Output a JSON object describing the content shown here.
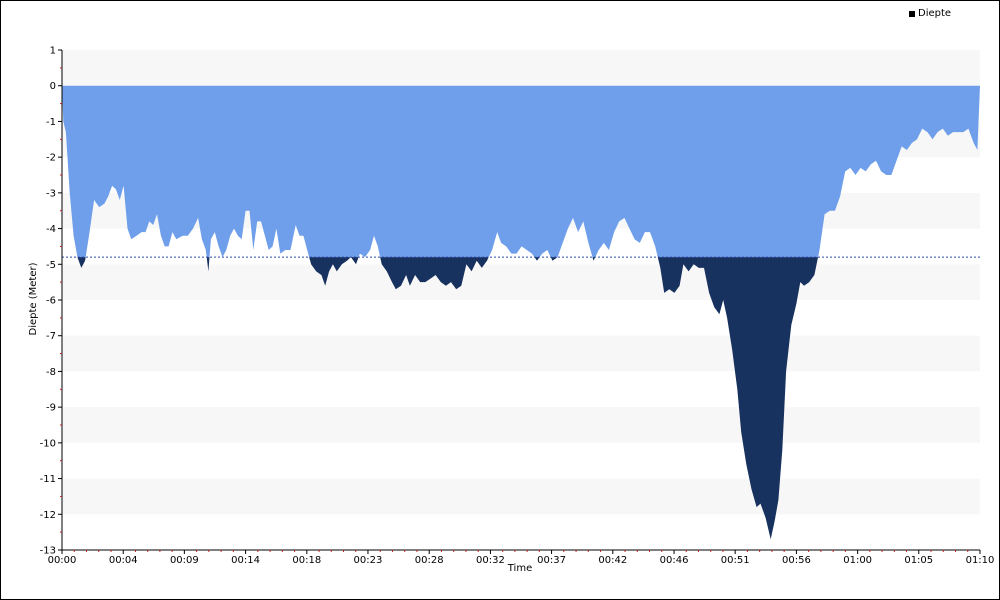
{
  "chart_data": {
    "type": "area",
    "title": "",
    "xlabel": "Time",
    "ylabel": "Diepte (Meter)",
    "legend": {
      "position": "top-right",
      "label": "Diepte"
    },
    "ylim": [
      -13,
      1
    ],
    "y_ticks": [
      "1",
      "0",
      "-1",
      "-2",
      "-3",
      "-4",
      "-5",
      "-6",
      "-7",
      "-8",
      "-9",
      "-10",
      "-11",
      "-12",
      "-13"
    ],
    "x_range_minutes": [
      0,
      71.5
    ],
    "x_ticks": [
      {
        "t": 0,
        "label": "00:00"
      },
      {
        "t": 4.77,
        "label": "00:04"
      },
      {
        "t": 9.53,
        "label": "00:09"
      },
      {
        "t": 14.3,
        "label": "00:14"
      },
      {
        "t": 19.07,
        "label": "00:18"
      },
      {
        "t": 23.83,
        "label": "00:23"
      },
      {
        "t": 28.6,
        "label": "00:28"
      },
      {
        "t": 33.37,
        "label": "00:32"
      },
      {
        "t": 38.13,
        "label": "00:37"
      },
      {
        "t": 42.9,
        "label": "00:42"
      },
      {
        "t": 47.67,
        "label": "00:46"
      },
      {
        "t": 52.43,
        "label": "00:51"
      },
      {
        "t": 57.2,
        "label": "00:56"
      },
      {
        "t": 61.97,
        "label": "01:00"
      },
      {
        "t": 66.73,
        "label": "01:05"
      },
      {
        "t": 71.5,
        "label": "01:10"
      }
    ],
    "threshold": -4.8,
    "grid": true,
    "colors": {
      "above": "#6f9fea",
      "below": "#18325f",
      "band": "#f7f7f7",
      "threshold_line": "#2a4aaa",
      "tick_mark": "#c02020"
    },
    "series": [
      {
        "name": "Diepte",
        "points": [
          [
            0,
            0
          ],
          [
            0.1,
            -1.0
          ],
          [
            0.3,
            -1.3
          ],
          [
            0.6,
            -3.0
          ],
          [
            0.9,
            -4.2
          ],
          [
            1.2,
            -4.8
          ],
          [
            1.5,
            -5.1
          ],
          [
            1.8,
            -4.9
          ],
          [
            2.1,
            -4.2
          ],
          [
            2.5,
            -3.2
          ],
          [
            2.9,
            -3.4
          ],
          [
            3.3,
            -3.3
          ],
          [
            3.6,
            -3.1
          ],
          [
            3.9,
            -2.8
          ],
          [
            4.2,
            -2.9
          ],
          [
            4.5,
            -3.2
          ],
          [
            4.8,
            -2.8
          ],
          [
            5.1,
            -4.0
          ],
          [
            5.4,
            -4.3
          ],
          [
            5.8,
            -4.2
          ],
          [
            6.2,
            -4.1
          ],
          [
            6.5,
            -4.1
          ],
          [
            6.8,
            -3.8
          ],
          [
            7.1,
            -3.9
          ],
          [
            7.4,
            -3.6
          ],
          [
            7.7,
            -4.2
          ],
          [
            8.0,
            -4.5
          ],
          [
            8.3,
            -4.5
          ],
          [
            8.6,
            -4.1
          ],
          [
            8.9,
            -4.3
          ],
          [
            9.4,
            -4.2
          ],
          [
            9.8,
            -4.2
          ],
          [
            10.2,
            -4.0
          ],
          [
            10.6,
            -3.7
          ],
          [
            10.9,
            -4.3
          ],
          [
            11.2,
            -4.6
          ],
          [
            11.4,
            -5.2
          ],
          [
            11.6,
            -4.3
          ],
          [
            11.9,
            -4.1
          ],
          [
            12.2,
            -4.5
          ],
          [
            12.5,
            -4.8
          ],
          [
            12.8,
            -4.6
          ],
          [
            13.1,
            -4.2
          ],
          [
            13.4,
            -4.0
          ],
          [
            13.7,
            -4.2
          ],
          [
            14.0,
            -4.3
          ],
          [
            14.3,
            -3.5
          ],
          [
            14.6,
            -3.5
          ],
          [
            14.9,
            -4.6
          ],
          [
            15.2,
            -3.8
          ],
          [
            15.5,
            -3.8
          ],
          [
            15.8,
            -4.2
          ],
          [
            16.1,
            -4.6
          ],
          [
            16.4,
            -4.5
          ],
          [
            16.7,
            -4.0
          ],
          [
            17.0,
            -4.7
          ],
          [
            17.4,
            -4.6
          ],
          [
            17.8,
            -4.6
          ],
          [
            18.2,
            -3.9
          ],
          [
            18.5,
            -4.2
          ],
          [
            18.8,
            -4.2
          ],
          [
            19.1,
            -4.6
          ],
          [
            19.4,
            -5.0
          ],
          [
            19.8,
            -5.2
          ],
          [
            20.2,
            -5.3
          ],
          [
            20.5,
            -5.6
          ],
          [
            20.8,
            -5.2
          ],
          [
            21.1,
            -5.0
          ],
          [
            21.4,
            -5.2
          ],
          [
            21.8,
            -5.0
          ],
          [
            22.2,
            -4.9
          ],
          [
            22.5,
            -4.8
          ],
          [
            22.9,
            -5.0
          ],
          [
            23.2,
            -4.7
          ],
          [
            23.6,
            -4.8
          ],
          [
            24.0,
            -4.6
          ],
          [
            24.3,
            -4.2
          ],
          [
            24.6,
            -4.5
          ],
          [
            24.9,
            -5.0
          ],
          [
            25.3,
            -5.2
          ],
          [
            25.7,
            -5.5
          ],
          [
            26.0,
            -5.7
          ],
          [
            26.4,
            -5.6
          ],
          [
            26.8,
            -5.3
          ],
          [
            27.1,
            -5.6
          ],
          [
            27.5,
            -5.3
          ],
          [
            27.9,
            -5.5
          ],
          [
            28.3,
            -5.5
          ],
          [
            28.7,
            -5.4
          ],
          [
            29.1,
            -5.3
          ],
          [
            29.5,
            -5.5
          ],
          [
            29.9,
            -5.6
          ],
          [
            30.3,
            -5.5
          ],
          [
            30.7,
            -5.7
          ],
          [
            31.1,
            -5.6
          ],
          [
            31.5,
            -5.0
          ],
          [
            31.9,
            -5.2
          ],
          [
            32.3,
            -4.9
          ],
          [
            32.7,
            -5.1
          ],
          [
            33.1,
            -4.9
          ],
          [
            33.5,
            -4.6
          ],
          [
            33.9,
            -4.1
          ],
          [
            34.2,
            -4.4
          ],
          [
            34.6,
            -4.5
          ],
          [
            35.0,
            -4.7
          ],
          [
            35.4,
            -4.7
          ],
          [
            35.8,
            -4.5
          ],
          [
            36.2,
            -4.6
          ],
          [
            36.6,
            -4.7
          ],
          [
            37.0,
            -4.9
          ],
          [
            37.4,
            -4.7
          ],
          [
            37.8,
            -4.6
          ],
          [
            38.2,
            -4.9
          ],
          [
            38.6,
            -4.8
          ],
          [
            39.0,
            -4.4
          ],
          [
            39.4,
            -4.0
          ],
          [
            39.8,
            -3.7
          ],
          [
            40.2,
            -4.1
          ],
          [
            40.6,
            -3.8
          ],
          [
            41.0,
            -4.4
          ],
          [
            41.4,
            -4.9
          ],
          [
            41.8,
            -4.6
          ],
          [
            42.2,
            -4.4
          ],
          [
            42.6,
            -4.6
          ],
          [
            43.0,
            -4.1
          ],
          [
            43.4,
            -3.8
          ],
          [
            43.8,
            -3.7
          ],
          [
            44.2,
            -4.0
          ],
          [
            44.6,
            -4.3
          ],
          [
            45.0,
            -4.4
          ],
          [
            45.4,
            -4.1
          ],
          [
            45.8,
            -4.1
          ],
          [
            46.2,
            -4.5
          ],
          [
            46.6,
            -5.1
          ],
          [
            46.9,
            -5.8
          ],
          [
            47.3,
            -5.7
          ],
          [
            47.7,
            -5.8
          ],
          [
            48.1,
            -5.6
          ],
          [
            48.4,
            -5.0
          ],
          [
            48.8,
            -5.2
          ],
          [
            49.2,
            -5.0
          ],
          [
            49.6,
            -5.1
          ],
          [
            50.0,
            -5.1
          ],
          [
            50.4,
            -5.8
          ],
          [
            50.8,
            -6.2
          ],
          [
            51.2,
            -6.4
          ],
          [
            51.5,
            -6.0
          ],
          [
            51.8,
            -6.5
          ],
          [
            52.2,
            -7.4
          ],
          [
            52.6,
            -8.5
          ],
          [
            52.9,
            -9.7
          ],
          [
            53.3,
            -10.6
          ],
          [
            53.7,
            -11.3
          ],
          [
            54.1,
            -11.8
          ],
          [
            54.4,
            -11.7
          ],
          [
            54.8,
            -12.1
          ],
          [
            55.2,
            -12.7
          ],
          [
            55.5,
            -12.2
          ],
          [
            55.8,
            -11.6
          ],
          [
            56.1,
            -10.2
          ],
          [
            56.4,
            -8.0
          ],
          [
            56.8,
            -6.7
          ],
          [
            57.2,
            -6.1
          ],
          [
            57.5,
            -5.5
          ],
          [
            57.8,
            -5.6
          ],
          [
            58.2,
            -5.5
          ],
          [
            58.6,
            -5.3
          ],
          [
            59.0,
            -4.6
          ],
          [
            59.4,
            -3.6
          ],
          [
            59.8,
            -3.5
          ],
          [
            60.2,
            -3.5
          ],
          [
            60.6,
            -3.1
          ],
          [
            61.0,
            -2.4
          ],
          [
            61.4,
            -2.3
          ],
          [
            61.8,
            -2.5
          ],
          [
            62.2,
            -2.3
          ],
          [
            62.6,
            -2.4
          ],
          [
            63.0,
            -2.2
          ],
          [
            63.4,
            -2.1
          ],
          [
            63.8,
            -2.4
          ],
          [
            64.2,
            -2.5
          ],
          [
            64.6,
            -2.5
          ],
          [
            65.0,
            -2.1
          ],
          [
            65.4,
            -1.7
          ],
          [
            65.8,
            -1.8
          ],
          [
            66.2,
            -1.6
          ],
          [
            66.6,
            -1.5
          ],
          [
            67.0,
            -1.2
          ],
          [
            67.4,
            -1.3
          ],
          [
            67.8,
            -1.5
          ],
          [
            68.2,
            -1.3
          ],
          [
            68.6,
            -1.2
          ],
          [
            69.0,
            -1.4
          ],
          [
            69.4,
            -1.3
          ],
          [
            69.8,
            -1.3
          ],
          [
            70.2,
            -1.3
          ],
          [
            70.6,
            -1.2
          ],
          [
            71.0,
            -1.6
          ],
          [
            71.3,
            -1.8
          ],
          [
            71.5,
            0
          ]
        ]
      }
    ]
  }
}
